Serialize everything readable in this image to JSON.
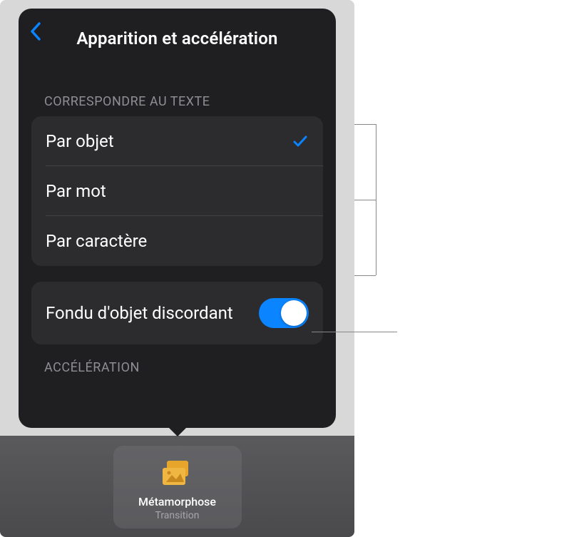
{
  "panel": {
    "title": "Apparition et accélération"
  },
  "matchText": {
    "header": "Correspondre au texte",
    "options": [
      {
        "label": "Par objet",
        "selected": true
      },
      {
        "label": "Par mot",
        "selected": false
      },
      {
        "label": "Par caractère",
        "selected": false
      }
    ]
  },
  "fade": {
    "label": "Fondu d'objet discordant",
    "enabled": true
  },
  "acceleration": {
    "header": "Accélération"
  },
  "transition": {
    "name": "Métamorphose",
    "sub": "Transition"
  }
}
